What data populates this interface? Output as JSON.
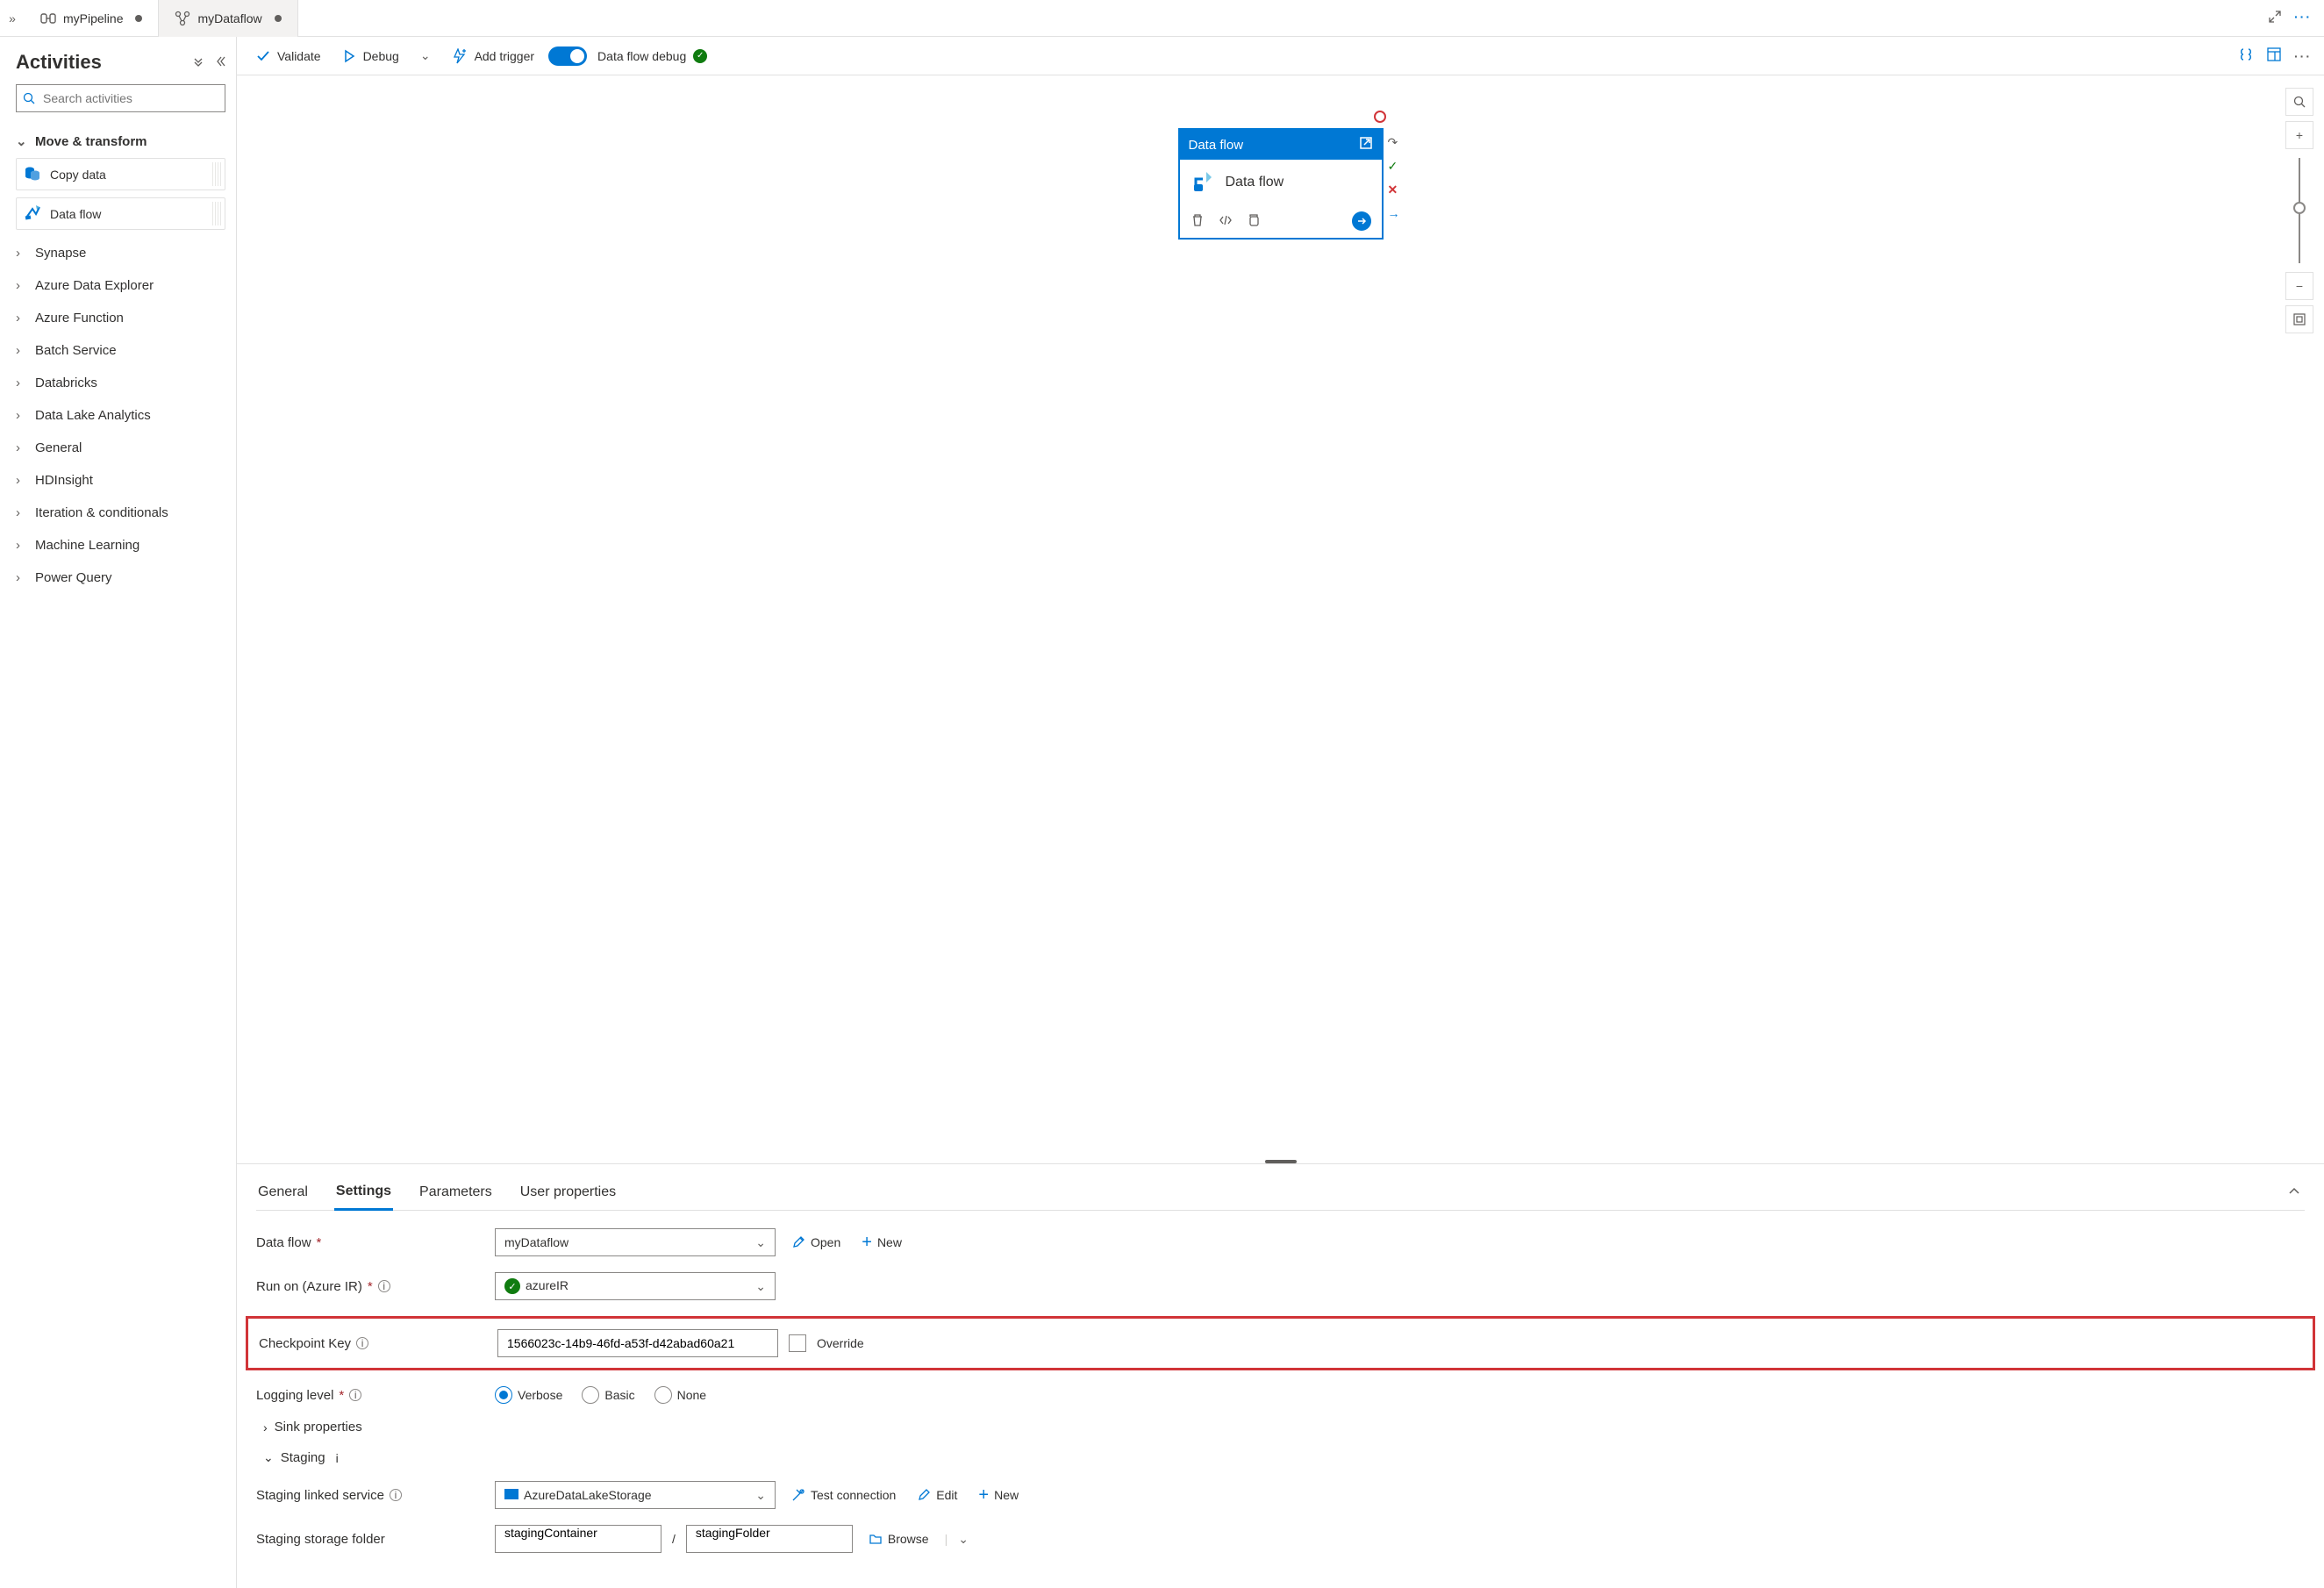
{
  "tabs": [
    {
      "label": "myPipeline",
      "active": true,
      "dirty": true
    },
    {
      "label": "myDataflow",
      "active": false,
      "dirty": true
    }
  ],
  "sidebar": {
    "title": "Activities",
    "search_placeholder": "Search activities",
    "categories": {
      "move_transform": "Move & transform",
      "items": [
        "Synapse",
        "Azure Data Explorer",
        "Azure Function",
        "Batch Service",
        "Databricks",
        "Data Lake Analytics",
        "General",
        "HDInsight",
        "Iteration & conditionals",
        "Machine Learning",
        "Power Query"
      ]
    },
    "activities": [
      {
        "name": "Copy data"
      },
      {
        "name": "Data flow"
      }
    ]
  },
  "toolbar": {
    "validate": "Validate",
    "debug": "Debug",
    "add_trigger": "Add trigger",
    "dataflow_debug": "Data flow debug"
  },
  "canvas": {
    "node_title": "Data flow",
    "node_name": "Data flow"
  },
  "prop_tabs": [
    "General",
    "Settings",
    "Parameters",
    "User properties"
  ],
  "prop_tabs_active": 1,
  "form": {
    "dataflow_label": "Data flow",
    "dataflow_value": "myDataflow",
    "open": "Open",
    "new": "New",
    "runon_label": "Run on (Azure IR)",
    "runon_value": "azureIR",
    "checkpoint_label": "Checkpoint Key",
    "checkpoint_value": "1566023c-14b9-46fd-a53f-d42abad60a21",
    "override": "Override",
    "logging_label": "Logging level",
    "logging_options": [
      "Verbose",
      "Basic",
      "None"
    ],
    "logging_selected": 0,
    "sink_properties": "Sink properties",
    "staging": "Staging",
    "staging_linked_label": "Staging linked service",
    "staging_linked_value": "AzureDataLakeStorage",
    "test_connection": "Test connection",
    "edit": "Edit",
    "staging_folder_label": "Staging storage folder",
    "container_value": "stagingContainer",
    "folder_value": "stagingFolder",
    "browse": "Browse"
  }
}
